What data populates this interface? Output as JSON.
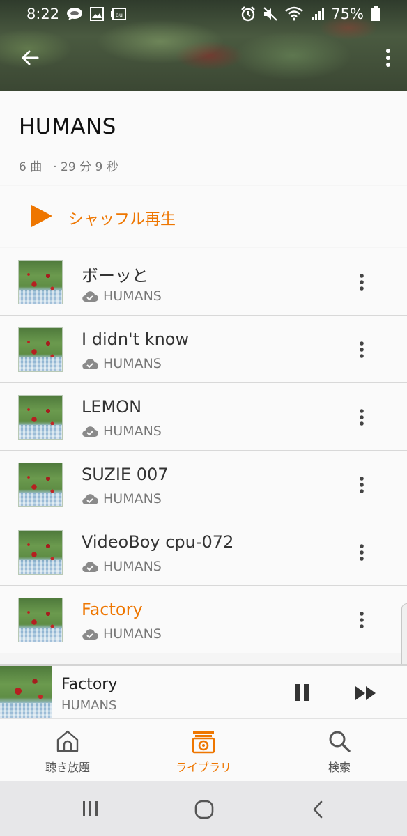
{
  "status_bar": {
    "time": "8:22",
    "battery": "75%",
    "left_icons": [
      "chat-bubble-icon",
      "image-icon",
      "au-carrier-icon"
    ],
    "right_icons": [
      "alarm-icon",
      "mute-icon",
      "wifi-icon",
      "signal-icon",
      "battery-icon"
    ]
  },
  "app_bar": {
    "back_icon": "arrow-left-icon",
    "menu_icon": "more-vert-icon"
  },
  "album": {
    "title": "HUMANS",
    "track_count": "6 曲",
    "duration": "· 29 分 9 秒"
  },
  "shuffle": {
    "label": "シャッフル再生",
    "icon": "play-triangle-icon"
  },
  "tracks": [
    {
      "title": "ボーッと",
      "artist": "HUMANS",
      "playing": false
    },
    {
      "title": "I didn't know",
      "artist": "HUMANS",
      "playing": false
    },
    {
      "title": "LEMON",
      "artist": "HUMANS",
      "playing": false
    },
    {
      "title": "SUZIE 007",
      "artist": "HUMANS",
      "playing": false
    },
    {
      "title": "VideoBoy cpu-072",
      "artist": "HUMANS",
      "playing": false
    },
    {
      "title": "Factory",
      "artist": "HUMANS",
      "playing": true
    }
  ],
  "mini_player": {
    "title": "Factory",
    "artist": "HUMANS",
    "state": "playing"
  },
  "bottom_nav": [
    {
      "label": "聴き放題",
      "icon": "home-icon",
      "active": false
    },
    {
      "label": "ライブラリ",
      "icon": "library-icon",
      "active": true
    },
    {
      "label": "検索",
      "icon": "search-icon",
      "active": false
    }
  ],
  "colors": {
    "accent": "#ee7600",
    "text_primary": "#333333",
    "text_secondary": "#777777",
    "divider": "#d8d8d8",
    "background": "#fafafa"
  }
}
